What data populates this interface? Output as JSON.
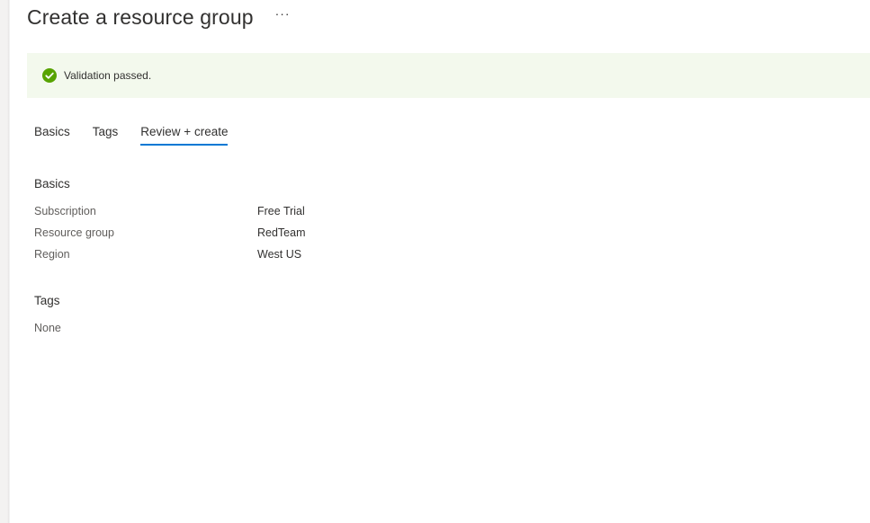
{
  "header": {
    "title": "Create a resource group",
    "more_label": "···"
  },
  "banner": {
    "icon": "check-circle-icon",
    "status_color": "#57a300",
    "text": "Validation passed."
  },
  "tabs": [
    {
      "label": "Basics",
      "active": false
    },
    {
      "label": "Tags",
      "active": false
    },
    {
      "label": "Review + create",
      "active": true
    }
  ],
  "basics": {
    "heading": "Basics",
    "rows": [
      {
        "label": "Subscription",
        "value": "Free Trial"
      },
      {
        "label": "Resource group",
        "value": "RedTeam"
      },
      {
        "label": "Region",
        "value": "West US"
      }
    ]
  },
  "tags": {
    "heading": "Tags",
    "value": "None"
  },
  "colors": {
    "accent": "#0078d4",
    "banner_bg": "#f3f9ed"
  }
}
